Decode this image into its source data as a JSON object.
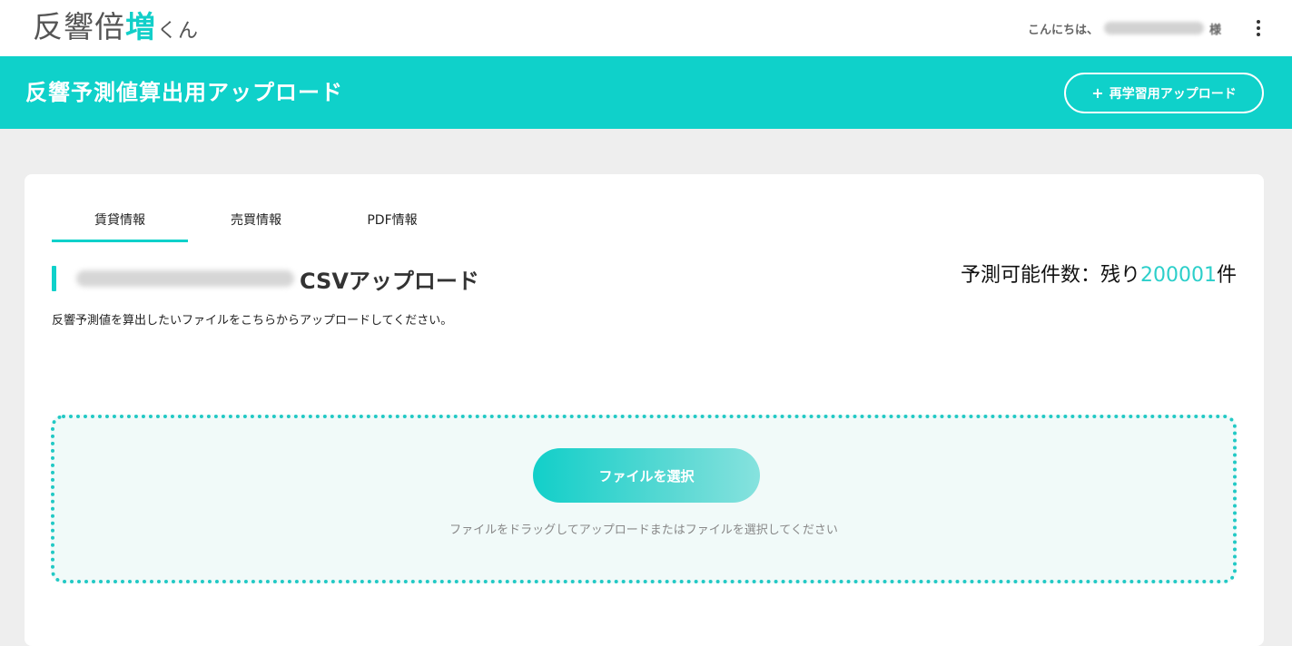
{
  "header": {
    "logo": {
      "part1": "反響倍",
      "accent": "増",
      "part2": "くん"
    },
    "greeting": "こんにちは、",
    "user_name": "",
    "honorific": "様",
    "menu_icon": "kebab-menu-icon"
  },
  "banner": {
    "title": "反響予測値算出用アップロード",
    "relearn_button": {
      "icon": "plus-icon",
      "plus": "+",
      "label": "再学習用アップロード"
    }
  },
  "tabs": [
    {
      "label": "賃貸情報",
      "active": true
    },
    {
      "label": "売買情報",
      "active": false
    },
    {
      "label": "PDF情報",
      "active": false
    }
  ],
  "section": {
    "title": "CSVアップロード",
    "description": "反響予測値を算出したいファイルをこちらからアップロードしてください。"
  },
  "remaining": {
    "label": "予測可能件数：残り",
    "count": "200001",
    "unit": "件"
  },
  "upload": {
    "button_label": "ファイルを選択",
    "hint": "ファイルをドラッグしてアップロードまたはファイルを選択してください"
  },
  "colors": {
    "accent": "#0fd1ca",
    "count": "#2ccfca",
    "page_bg": "#eeeeee"
  }
}
